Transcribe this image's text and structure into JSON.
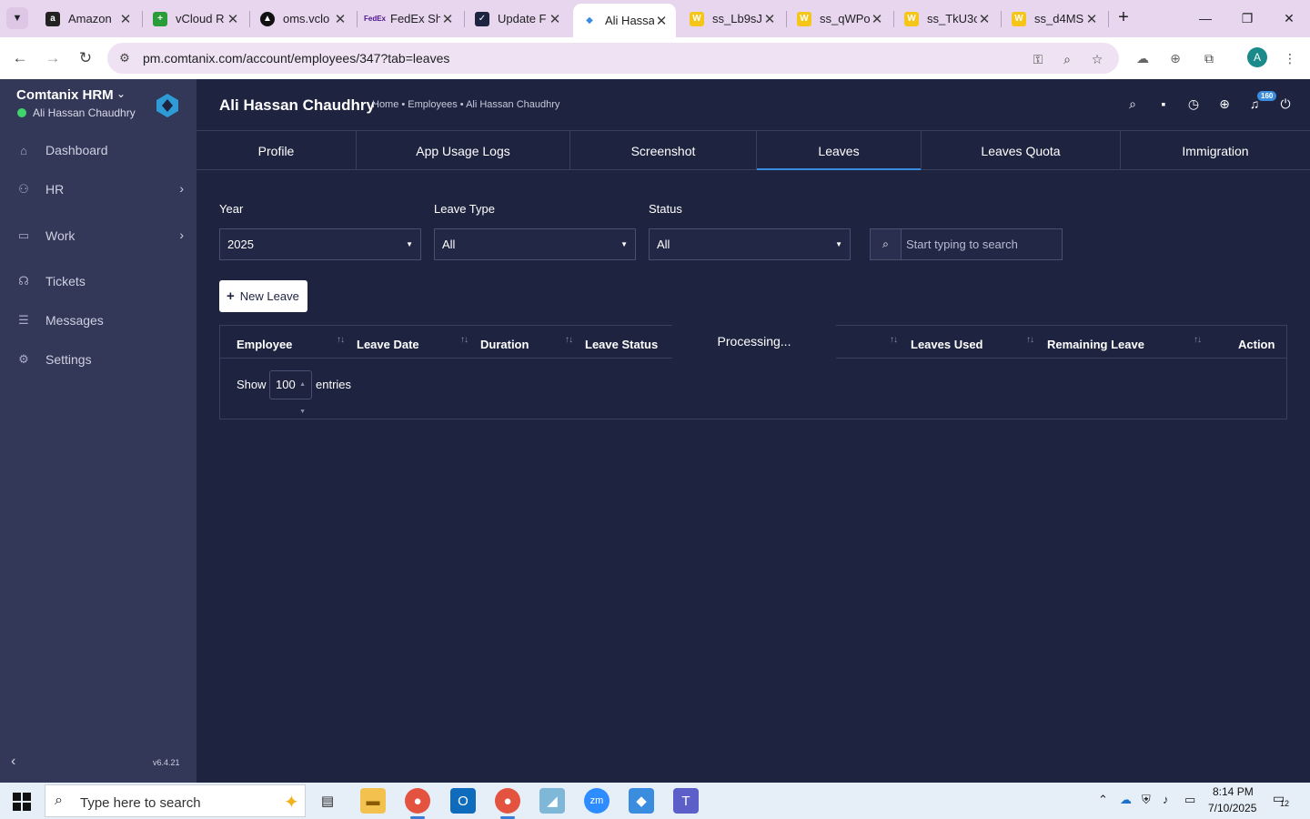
{
  "browser": {
    "tabs": [
      {
        "title": "Amazon",
        "favicon": "amazon-icon"
      },
      {
        "title": "vCloud R",
        "favicon": "vcloud-icon"
      },
      {
        "title": "oms.vclo",
        "favicon": "oms-icon"
      },
      {
        "title": "FedEx Sh",
        "favicon": "fedex-icon"
      },
      {
        "title": "Update F",
        "favicon": "update-icon"
      },
      {
        "title": "Ali Hassa",
        "favicon": "comtanix-icon"
      },
      {
        "title": "ss_Lb9sJ",
        "favicon": "w-icon"
      },
      {
        "title": "ss_qWPo",
        "favicon": "w-icon"
      },
      {
        "title": "ss_TkU3c",
        "favicon": "w-icon"
      },
      {
        "title": "ss_d4MS",
        "favicon": "w-icon"
      }
    ],
    "active_tab": 5,
    "url": "pm.comtanix.com/account/employees/347?tab=leaves",
    "profile_initial": "A"
  },
  "app": {
    "brand": "Comtanix HRM",
    "current_user": "Ali Hassan Chaudhry",
    "version": "v6.4.21",
    "sidebar": [
      {
        "label": "Dashboard",
        "icon": "home-icon",
        "has_children": false
      },
      {
        "label": "HR",
        "icon": "people-icon",
        "has_children": true
      },
      {
        "label": "Work",
        "icon": "briefcase-icon",
        "has_children": true
      },
      {
        "label": "Tickets",
        "icon": "headset-icon",
        "has_children": false
      },
      {
        "label": "Messages",
        "icon": "chat-icon",
        "has_children": false
      },
      {
        "label": "Settings",
        "icon": "gear-icon",
        "has_children": false
      }
    ],
    "page_title": "Ali Hassan Chaudhry",
    "breadcrumb": "Home • Employees • Ali Hassan Chaudhry",
    "notification_count": "160",
    "profile_tabs": [
      "Profile",
      "App Usage Logs",
      "Screenshot",
      "Leaves",
      "Leaves Quota",
      "Immigration"
    ],
    "active_profile_tab": "Leaves",
    "filters": {
      "year_label": "Year",
      "year_value": "2025",
      "leave_type_label": "Leave Type",
      "leave_type_value": "All",
      "status_label": "Status",
      "status_value": "All",
      "search_placeholder": "Start typing to search"
    },
    "new_leave_label": "New Leave",
    "table": {
      "columns": [
        "Employee",
        "Leave Date",
        "Duration",
        "Leave Status",
        "Leaves Used",
        "Remaining Leave",
        "Action"
      ],
      "processing_text": "Processing...",
      "show_label": "Show",
      "page_length": "100",
      "entries_label": "entries"
    }
  },
  "taskbar": {
    "search_placeholder": "Type here to search",
    "time": "8:14 PM",
    "date": "7/10/2025",
    "notifications": "12"
  }
}
